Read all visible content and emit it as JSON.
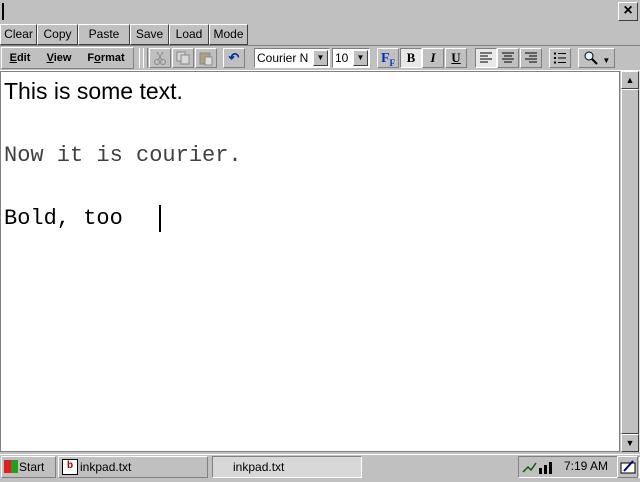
{
  "window": {
    "close_label": "×"
  },
  "command_bar": {
    "buttons": [
      {
        "label": "Clear"
      },
      {
        "label": "Copy"
      },
      {
        "label": "Paste"
      },
      {
        "label": "Save"
      },
      {
        "label": "Load"
      },
      {
        "label": "Mode"
      }
    ]
  },
  "menus": [
    {
      "label": "Edit"
    },
    {
      "label": "View"
    },
    {
      "label": "Format"
    }
  ],
  "toolbar": {
    "font_name": "Courier N",
    "font_size": "10",
    "bold": "B",
    "italic": "I",
    "underline": "U",
    "font_icon": "F",
    "bold_active": true,
    "align_left_active": true,
    "undo": "↶"
  },
  "document": {
    "lines": [
      "This is some text.",
      "Now it is courier.",
      "Bold, too"
    ]
  },
  "taskbar": {
    "start_label": "Start",
    "task1_label": "inkpad.txt",
    "task2_label": "inkpad.txt",
    "clock": "7:19 AM"
  },
  "icons": [
    "close-icon",
    "cut-icon",
    "copy-icon",
    "paste-icon",
    "undo-icon",
    "font-icon",
    "align-left-icon",
    "align-center-icon",
    "align-right-icon",
    "bullets-icon",
    "zoom-icon",
    "scroll-up-icon",
    "scroll-down-icon",
    "start-icon",
    "inkpad-icon",
    "network-icon",
    "input-panel-icon"
  ]
}
